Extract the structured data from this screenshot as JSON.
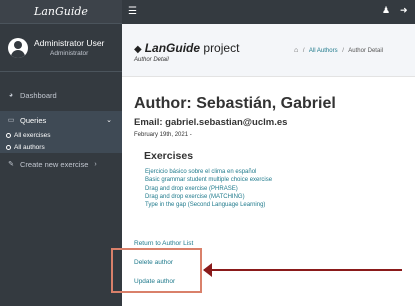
{
  "brand": "LanGuide",
  "user": {
    "name": "Administrator User",
    "role": "Administrator"
  },
  "nav": {
    "dashboard": "Dashboard",
    "queries": "Queries",
    "sub_items": [
      "All exercises",
      "All authors"
    ],
    "create": "Create new exercise"
  },
  "header": {
    "app_name": "LanGuide",
    "app_suffix": "project",
    "subtitle": "Author Detail",
    "breadcrumb": {
      "link": "All Authors",
      "separator": "/",
      "current": "Author Detail"
    }
  },
  "author": {
    "title": "Author: Sebastián, Gabriel",
    "email": "Email: gabriel.sebastian@uclm.es",
    "date": "February 19th, 2021 -"
  },
  "exercises": {
    "heading": "Exercises",
    "items": [
      "Ejercicio básico sobre el clima en español",
      "Basic grammar student multiple choice exercise",
      "Drag and drop exercise (PHRASE)",
      "Drag and drop exercise (MATCHING)",
      "Type in the gap (Second Language Learning)"
    ]
  },
  "actions": {
    "return": "Return to Author List",
    "delete": "Delete author",
    "update": "Update author"
  },
  "icons": {
    "dashboard": "dashboard-icon",
    "queries": "monitor-icon",
    "create": "edit-icon",
    "menu": "hamburger-icon",
    "user": "user-icon",
    "logout": "logout-icon",
    "home": "home-icon"
  },
  "colors": {
    "sidebar": "#343a40",
    "active_nav": "#3f4a55",
    "link": "#1f7a8c",
    "highlight": "#d9806a",
    "arrow": "#8a1a1a"
  }
}
